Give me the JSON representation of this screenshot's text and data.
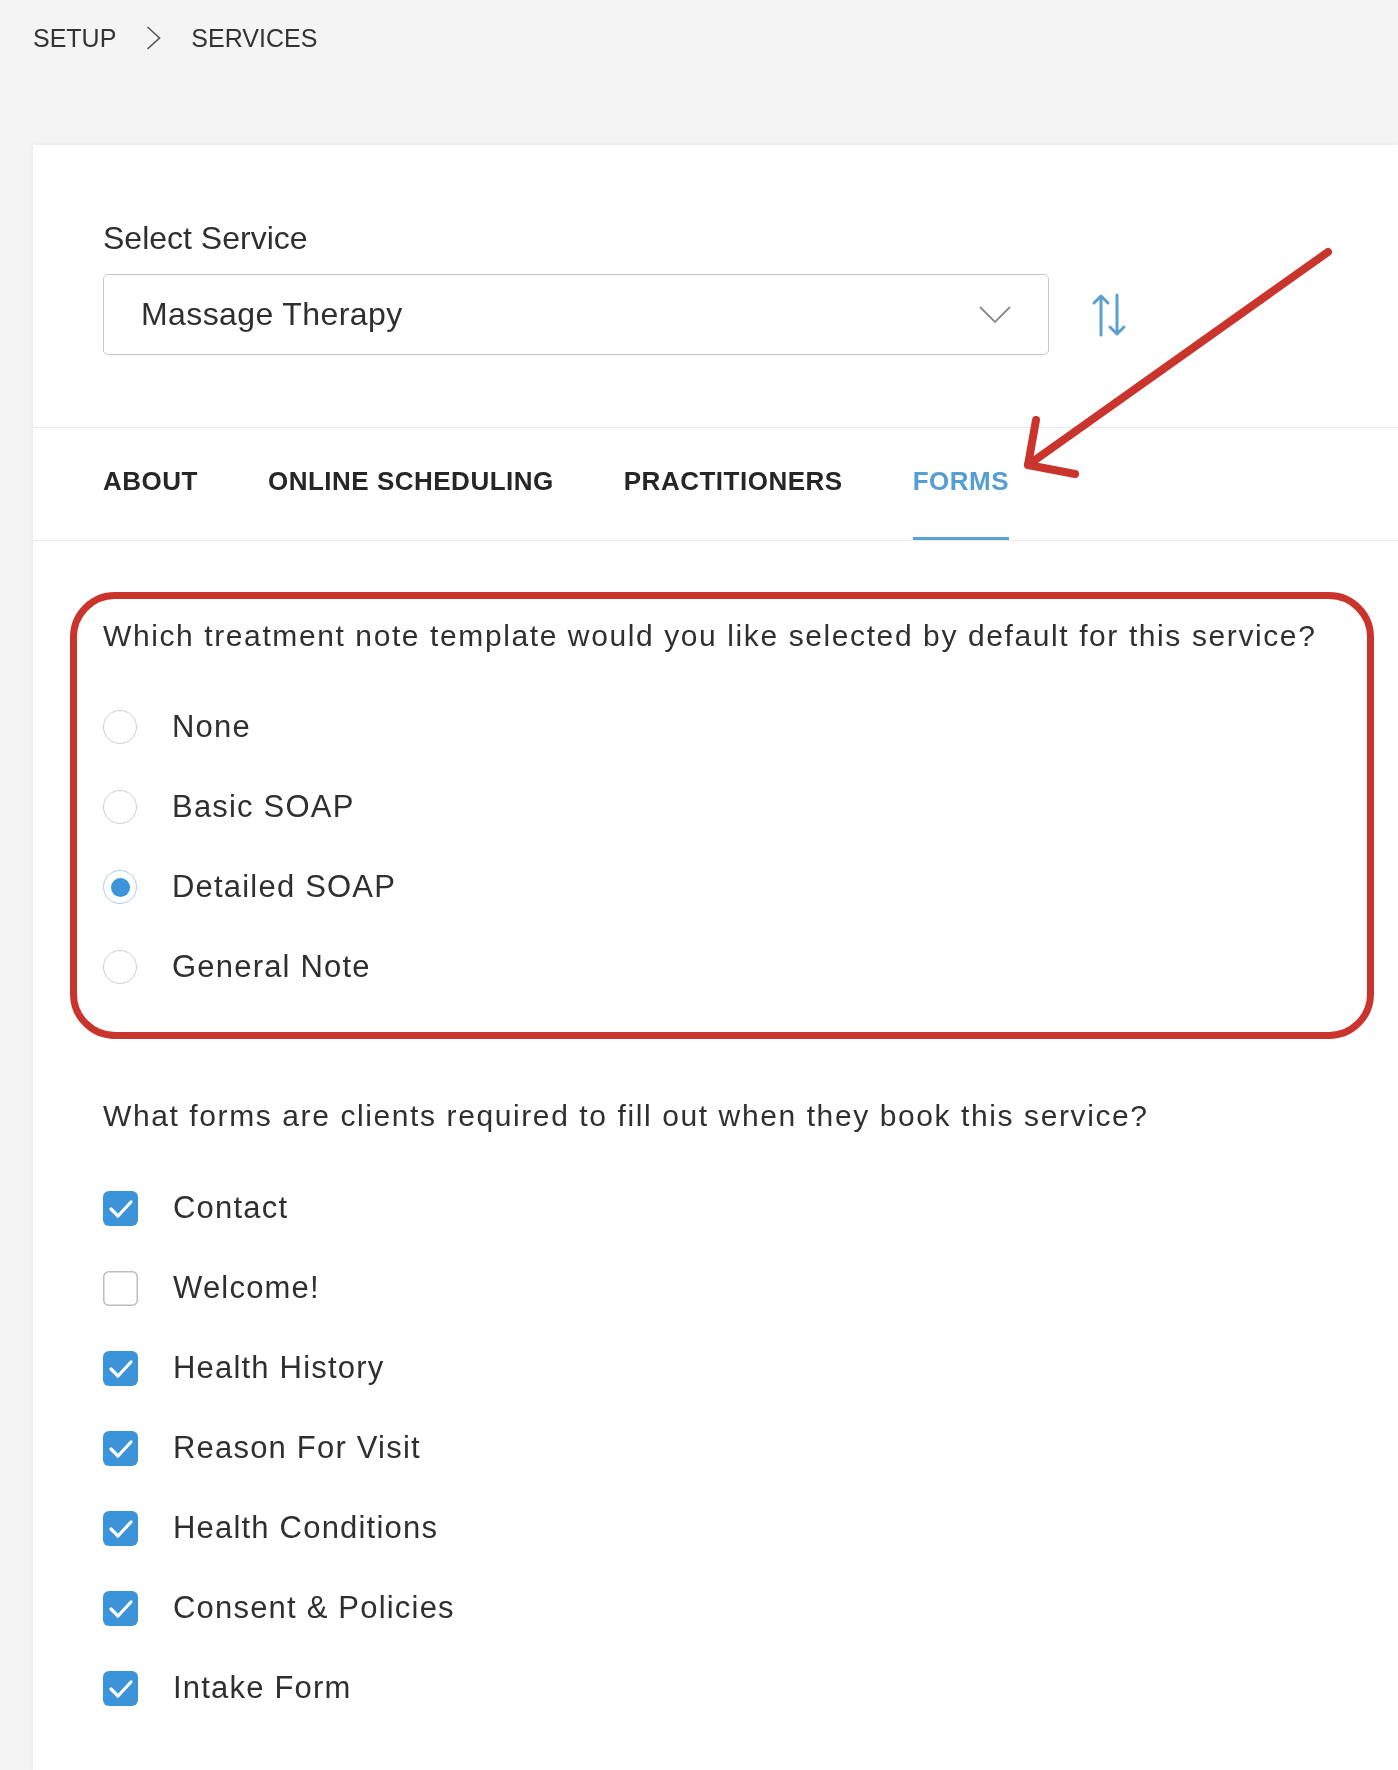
{
  "breadcrumb": [
    "SETUP",
    "SERVICES"
  ],
  "service_select": {
    "label": "Select Service",
    "value": "Massage Therapy"
  },
  "tabs": [
    {
      "label": "ABOUT",
      "selected": false,
      "arrow_pointer": false
    },
    {
      "label": "ONLINE SCHEDULING",
      "selected": false,
      "arrow_pointer": false
    },
    {
      "label": "PRACTITIONERS",
      "selected": false,
      "arrow_pointer": false
    },
    {
      "label": "FORMS",
      "selected": true,
      "arrow_pointer": true
    }
  ],
  "template_question": {
    "text": "Which treatment note template would you like selected by default for this service?",
    "highlighted": true,
    "options": [
      {
        "label": "None",
        "selected": false
      },
      {
        "label": "Basic SOAP",
        "selected": false
      },
      {
        "label": "Detailed SOAP",
        "selected": true
      },
      {
        "label": "General Note",
        "selected": false
      }
    ]
  },
  "forms_question": {
    "text": "What forms are clients required to fill out when they book this service?",
    "forms": [
      {
        "label": "Contact",
        "checked": true
      },
      {
        "label": "Welcome!",
        "checked": false
      },
      {
        "label": "Health History",
        "checked": true
      },
      {
        "label": "Reason For Visit",
        "checked": true
      },
      {
        "label": "Health Conditions",
        "checked": true
      },
      {
        "label": "Consent & Policies",
        "checked": true
      },
      {
        "label": "Intake Form",
        "checked": true
      }
    ]
  }
}
